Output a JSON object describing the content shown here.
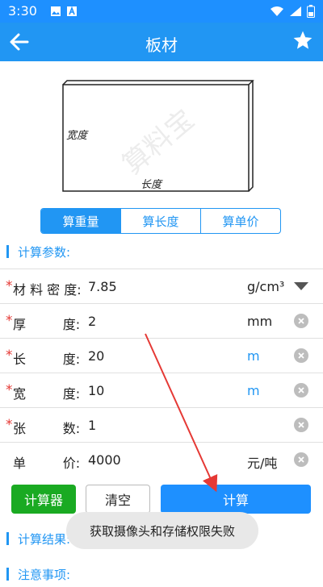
{
  "status_bar": {
    "time": "3:30"
  },
  "header": {
    "title": "板材"
  },
  "diagram": {
    "width_label": "宽度",
    "length_label": "长度",
    "watermark": "算料宝"
  },
  "segments": {
    "items": [
      {
        "label": "算重量",
        "active": true
      },
      {
        "label": "算长度",
        "active": false
      },
      {
        "label": "算单价",
        "active": false
      }
    ]
  },
  "params_section": {
    "title": "计算参数:"
  },
  "rows": [
    {
      "label": "材 料 密 度:",
      "value": "7.85",
      "unit": "g/cm³",
      "required": true
    },
    {
      "label": "厚         度:",
      "value": "2",
      "unit": "mm",
      "required": true
    },
    {
      "label": "长         度:",
      "value": "20",
      "unit": "m",
      "required": true
    },
    {
      "label": "宽         度:",
      "value": "10",
      "unit": "m",
      "required": true
    },
    {
      "label": "张         数:",
      "value": "1",
      "unit": "",
      "required": true
    },
    {
      "label": "单         价:",
      "value": "4000",
      "unit": "元/吨",
      "required": false
    }
  ],
  "buttons": {
    "calculator": "计算器",
    "clear": "清空",
    "calculate": "计算"
  },
  "results_section": {
    "title": "计算结果:"
  },
  "notes_section": {
    "title": "注意事项:"
  },
  "toast": {
    "message": "获取摄像头和存储权限失败"
  },
  "colors": {
    "primary": "#2196f3",
    "required_star": "#e53935",
    "calculator_button": "#1aaa22",
    "annotation_arrow": "#e53935"
  }
}
